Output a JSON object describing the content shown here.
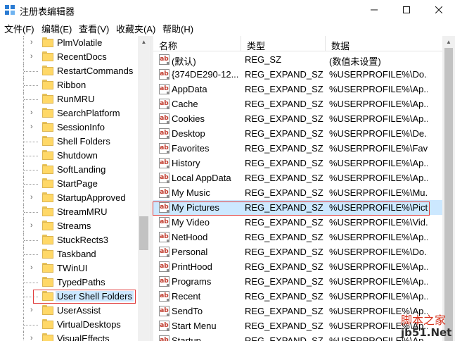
{
  "window": {
    "title": "注册表编辑器",
    "icon": "regedit-icon",
    "controls": [
      "minimize",
      "maximize",
      "close"
    ]
  },
  "menu": [
    "文件(F)",
    "编辑(E)",
    "查看(V)",
    "收藏夹(A)",
    "帮助(H)"
  ],
  "tree": {
    "items": [
      {
        "label": "PlmVolatile",
        "expandable": true
      },
      {
        "label": "RecentDocs",
        "expandable": true
      },
      {
        "label": "RestartCommands",
        "expandable": false
      },
      {
        "label": "Ribbon",
        "expandable": false
      },
      {
        "label": "RunMRU",
        "expandable": false
      },
      {
        "label": "SearchPlatform",
        "expandable": true
      },
      {
        "label": "SessionInfo",
        "expandable": true
      },
      {
        "label": "Shell Folders",
        "expandable": false
      },
      {
        "label": "Shutdown",
        "expandable": false
      },
      {
        "label": "SoftLanding",
        "expandable": false
      },
      {
        "label": "StartPage",
        "expandable": false
      },
      {
        "label": "StartupApproved",
        "expandable": true
      },
      {
        "label": "StreamMRU",
        "expandable": false
      },
      {
        "label": "Streams",
        "expandable": true
      },
      {
        "label": "StuckRects3",
        "expandable": false
      },
      {
        "label": "Taskband",
        "expandable": false
      },
      {
        "label": "TWinUI",
        "expandable": true
      },
      {
        "label": "TypedPaths",
        "expandable": false
      },
      {
        "label": "User Shell Folders",
        "expandable": false,
        "selected": true
      },
      {
        "label": "UserAssist",
        "expandable": true
      },
      {
        "label": "VirtualDesktops",
        "expandable": false
      },
      {
        "label": "VisualEffects",
        "expandable": true
      }
    ]
  },
  "values": {
    "columns": {
      "name": "名称",
      "type": "类型",
      "data": "数据"
    },
    "rows": [
      {
        "name": "(默认)",
        "type": "REG_SZ",
        "data": "(数值未设置)"
      },
      {
        "name": "{374DE290-12...",
        "type": "REG_EXPAND_SZ",
        "data": "%USERPROFILE%\\Do..."
      },
      {
        "name": "AppData",
        "type": "REG_EXPAND_SZ",
        "data": "%USERPROFILE%\\Ap..."
      },
      {
        "name": "Cache",
        "type": "REG_EXPAND_SZ",
        "data": "%USERPROFILE%\\Ap..."
      },
      {
        "name": "Cookies",
        "type": "REG_EXPAND_SZ",
        "data": "%USERPROFILE%\\Ap..."
      },
      {
        "name": "Desktop",
        "type": "REG_EXPAND_SZ",
        "data": "%USERPROFILE%\\De..."
      },
      {
        "name": "Favorites",
        "type": "REG_EXPAND_SZ",
        "data": "%USERPROFILE%\\Fav..."
      },
      {
        "name": "History",
        "type": "REG_EXPAND_SZ",
        "data": "%USERPROFILE%\\Ap..."
      },
      {
        "name": "Local AppData",
        "type": "REG_EXPAND_SZ",
        "data": "%USERPROFILE%\\Ap..."
      },
      {
        "name": "My Music",
        "type": "REG_EXPAND_SZ",
        "data": "%USERPROFILE%\\Mu..."
      },
      {
        "name": "My Pictures",
        "type": "REG_EXPAND_SZ",
        "data": "%USERPROFILE%\\Pict...",
        "selected": true
      },
      {
        "name": "My Video",
        "type": "REG_EXPAND_SZ",
        "data": "%USERPROFILE%\\Vid..."
      },
      {
        "name": "NetHood",
        "type": "REG_EXPAND_SZ",
        "data": "%USERPROFILE%\\Ap..."
      },
      {
        "name": "Personal",
        "type": "REG_EXPAND_SZ",
        "data": "%USERPROFILE%\\Do..."
      },
      {
        "name": "PrintHood",
        "type": "REG_EXPAND_SZ",
        "data": "%USERPROFILE%\\Ap..."
      },
      {
        "name": "Programs",
        "type": "REG_EXPAND_SZ",
        "data": "%USERPROFILE%\\Ap..."
      },
      {
        "name": "Recent",
        "type": "REG_EXPAND_SZ",
        "data": "%USERPROFILE%\\Ap..."
      },
      {
        "name": "SendTo",
        "type": "REG_EXPAND_SZ",
        "data": "%USERPROFILE%\\Ap..."
      },
      {
        "name": "Start Menu",
        "type": "REG_EXPAND_SZ",
        "data": "%USERPROFILE%\\Ap..."
      },
      {
        "name": "Startup",
        "type": "REG_EXPAND_SZ",
        "data": "%USERPROFILE%\\Ap..."
      }
    ]
  },
  "watermark": {
    "top": "脚本之家",
    "bottom": "jb51.Net"
  },
  "colors": {
    "selection": "#cce8ff",
    "highlight_border": "#e03c3c",
    "folder": "#ffd867"
  }
}
